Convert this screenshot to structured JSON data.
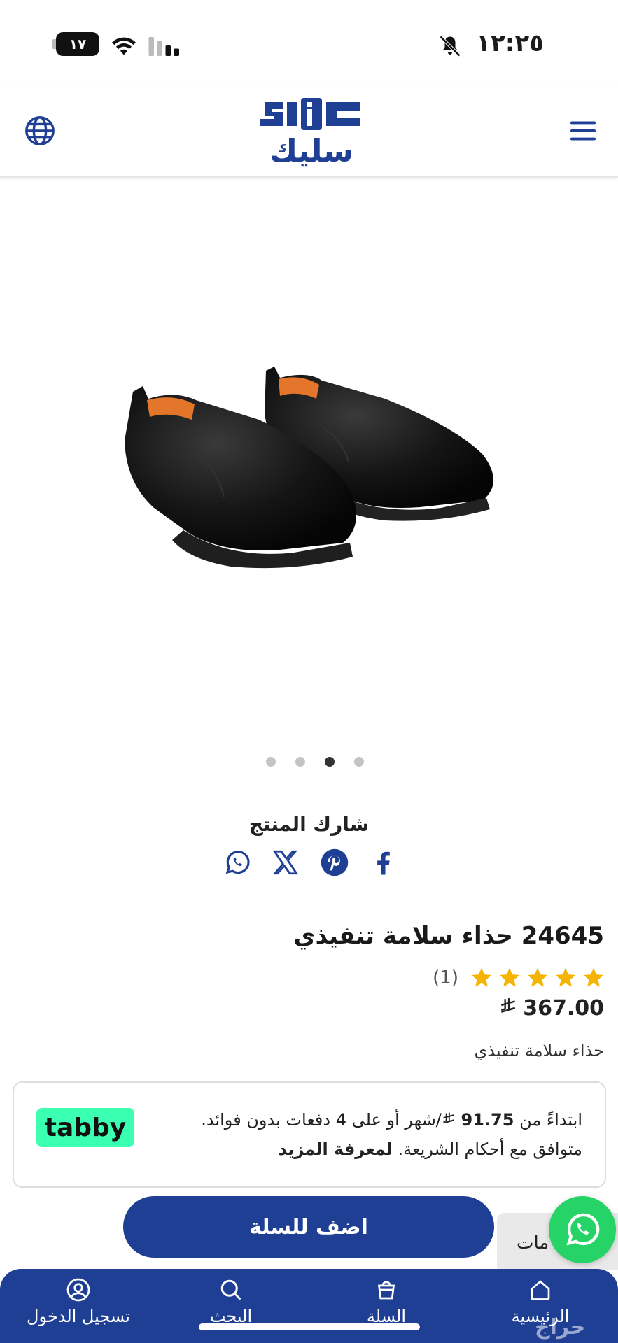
{
  "status_bar": {
    "time": "١٢:٢٥",
    "battery": "١٧"
  },
  "header": {
    "logo_latin": "slic",
    "logo_arabic": "سليك"
  },
  "gallery": {
    "image_alt": "safety-shoes-image",
    "slide_count": 4,
    "active_slide": 3
  },
  "share": {
    "label": "شارك المنتج",
    "icons": [
      "facebook-icon",
      "pinterest-icon",
      "x-icon",
      "whatsapp-icon"
    ]
  },
  "product": {
    "title": "24645 حذاء سلامة تنفيذي",
    "rating_value": 5,
    "rating_count": "(1)",
    "price": "367.00",
    "currency_symbol": "⃁",
    "short_description": "حذاء سلامة تنفيذي"
  },
  "tabby": {
    "line1_prefix": "ابتداءً من",
    "line1_amount": "91.75",
    "line1_currency": "⃁",
    "line1_suffix": "/شهر أو على 4 دفعات بدون فوائد.",
    "line2_text": "متوافق مع أحكام الشريعة.",
    "learn_more": "لمعرفة المزيد",
    "logo_text": "tabby"
  },
  "actions": {
    "add_to_cart": "اضف للسلة",
    "reviews_tab": "مات"
  },
  "bottom_nav": {
    "home": "الرئيسية",
    "cart": "السلة",
    "search": "البحث",
    "login": "تسجيل الدخول"
  },
  "watermark": "حراج",
  "colors": {
    "brand_blue": "#1f3f94",
    "star": "#f4b400",
    "tabby_green": "#3bffb1",
    "whatsapp_green": "#25d366"
  }
}
